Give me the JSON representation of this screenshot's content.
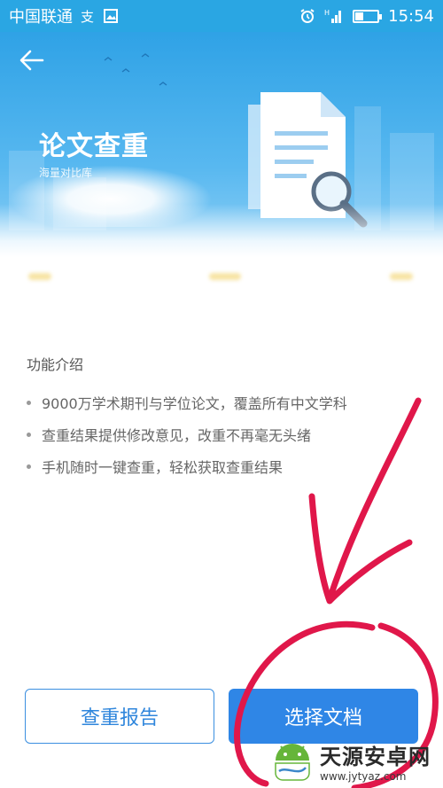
{
  "status_bar": {
    "carrier": "中国联通",
    "time": "15:54",
    "battery_level": 0.35,
    "network": "H"
  },
  "header": {
    "title": "论文查重",
    "subtitle": "海量对比库",
    "back_icon": "back-arrow-icon"
  },
  "content": {
    "section_title": "功能介绍",
    "features": [
      "9000万学术期刊与学位论文，覆盖所有中文学科",
      "查重结果提供修改意见，改重不再毫无头绪",
      "手机随时一键查重，轻松获取查重结果"
    ]
  },
  "buttons": {
    "report_label": "查重报告",
    "select_label": "选择文档"
  },
  "watermark": {
    "name": "天源安卓网",
    "url": "www.jytyaz.com"
  },
  "colors": {
    "primary": "#2f86e6",
    "header_bg": "#2fa2e6",
    "annotation": "#e0174a"
  }
}
